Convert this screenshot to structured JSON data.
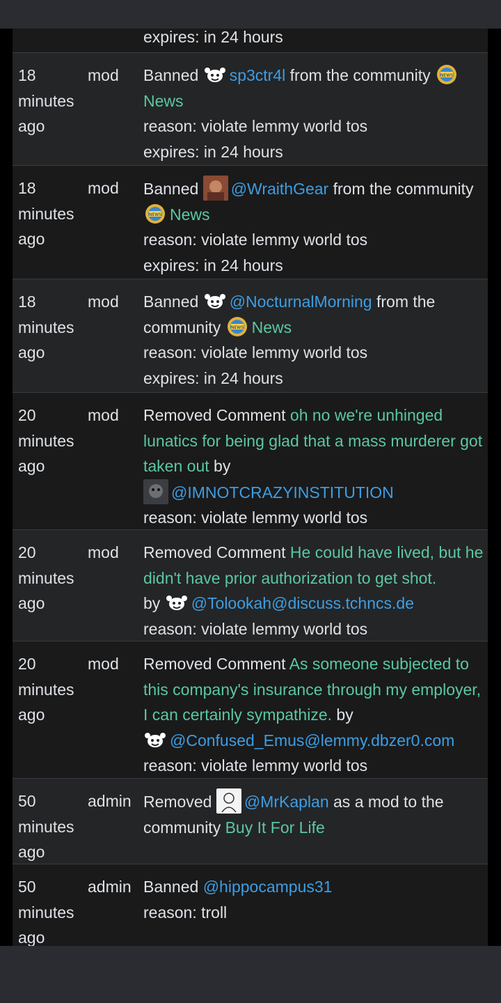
{
  "rows": [
    {
      "action": {
        "expires": "expires: in 24 hours"
      }
    },
    {
      "time": "18 minutes ago",
      "role": "mod",
      "action": {
        "verb": "Banned",
        "user": "sp3ctr4l",
        "mid": "from the community",
        "community": "News",
        "reason": "reason: violate lemmy world tos",
        "expires": "expires: in 24 hours"
      }
    },
    {
      "time": "18 minutes ago",
      "role": "mod",
      "action": {
        "verb": "Banned",
        "user": "@WraithGear",
        "mid": "from the community",
        "community": "News",
        "reason": "reason: violate lemmy world tos",
        "expires": "expires: in 24 hours"
      }
    },
    {
      "time": "18 minutes ago",
      "role": "mod",
      "action": {
        "verb": "Banned",
        "user": "@NocturnalMorning",
        "mid": "from the community",
        "community": "News",
        "reason": "reason: violate lemmy world tos",
        "expires": "expires: in 24 hours"
      }
    },
    {
      "time": "20 minutes ago",
      "role": "mod",
      "action": {
        "verb": "Removed Comment",
        "comment": "oh no we're unhinged lunatics for being glad that a mass murderer got taken out",
        "by": "by",
        "user": "@IMNOTCRAZYINSTITUTION",
        "reason": "reason: violate lemmy world tos"
      }
    },
    {
      "time": "20 minutes ago",
      "role": "mod",
      "action": {
        "verb": "Removed Comment",
        "comment": "He could have lived, but he didn't have prior authorization to get shot.",
        "by": "by",
        "user": "@Tolookah@discuss.tchncs.de",
        "reason": "reason: violate lemmy world tos"
      }
    },
    {
      "time": "20 minutes ago",
      "role": "mod",
      "action": {
        "verb": "Removed Comment",
        "comment": "As someone subjected to this company's insurance through my employer, I can certainly sympathize.",
        "by": "by",
        "user": "@Confused_Emus@lemmy.dbzer0.com",
        "reason": "reason: violate lemmy world tos"
      }
    },
    {
      "time": "50 minutes ago",
      "role": "admin",
      "action": {
        "verb": "Removed",
        "user": "@MrKaplan",
        "mid": "as a mod to the community",
        "community": "Buy It For Life"
      }
    },
    {
      "time": "50 minutes ago",
      "role": "admin",
      "action": {
        "verb": "Banned",
        "user": "@hippocampus31",
        "reason": "reason: troll"
      }
    }
  ]
}
